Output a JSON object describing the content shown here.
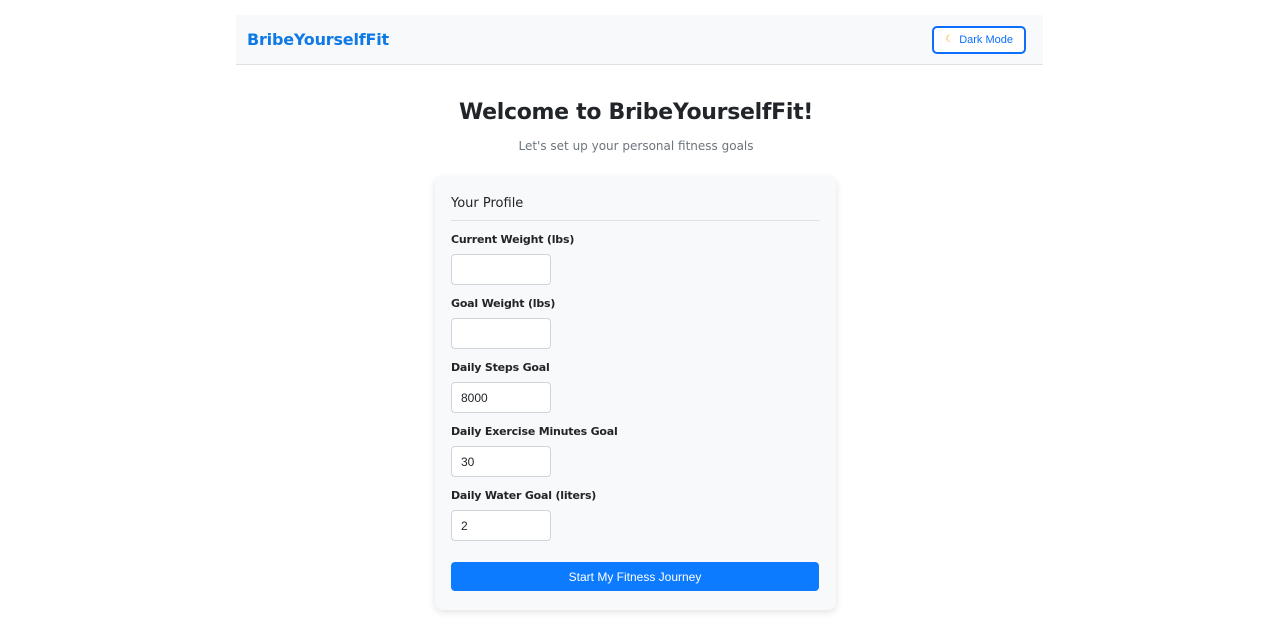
{
  "navbar": {
    "brand": "BribeYourselfFit",
    "dark_mode_label": "Dark Mode",
    "dark_mode_icon": "crescent-moon-icon"
  },
  "hero": {
    "title": "Welcome to BribeYourselfFit!",
    "subtitle": "Let's set up your personal fitness goals"
  },
  "profile": {
    "title": "Your Profile",
    "fields": [
      {
        "label": "Current Weight (lbs)",
        "value": ""
      },
      {
        "label": "Goal Weight (lbs)",
        "value": ""
      },
      {
        "label": "Daily Steps Goal",
        "value": "8000"
      },
      {
        "label": "Daily Exercise Minutes Goal",
        "value": "30"
      },
      {
        "label": "Daily Water Goal (liters)",
        "value": "2"
      }
    ],
    "submit_label": "Start My Fitness Journey"
  },
  "colors": {
    "accent": "#0d6efd",
    "brand": "#0d7ae6",
    "card_bg": "#f8f9fa"
  }
}
